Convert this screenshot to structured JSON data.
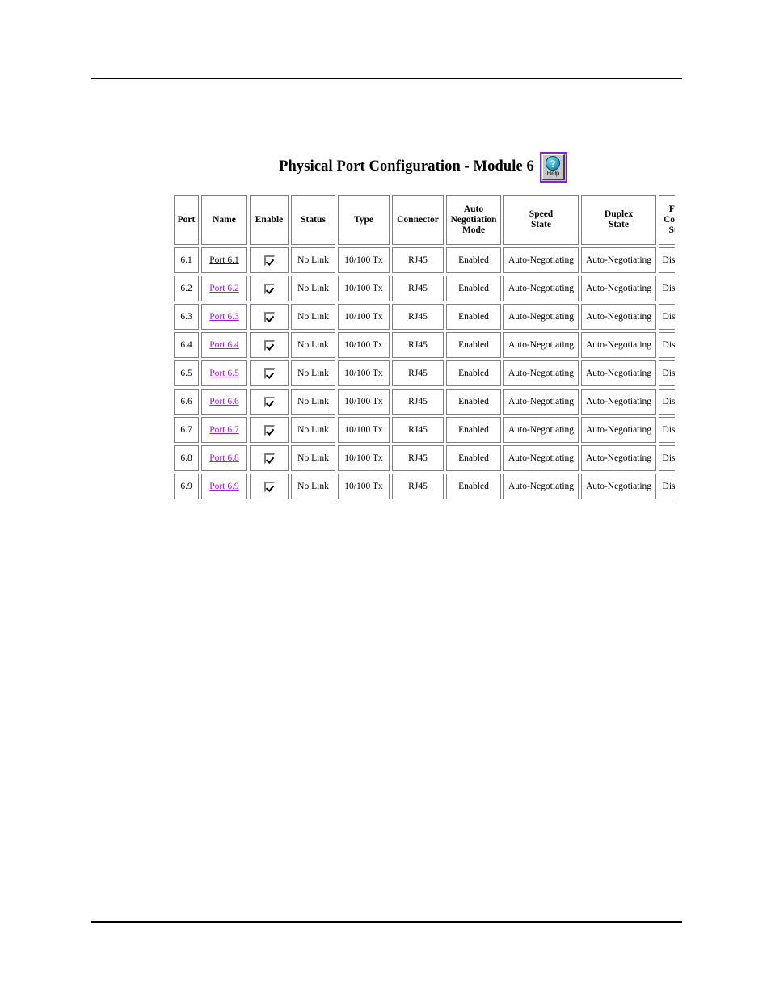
{
  "page": {
    "background": "#ffffff",
    "rules": [
      "top",
      "bottom"
    ]
  },
  "title": {
    "text": "Physical Port Configuration - Module 6"
  },
  "help_button": {
    "label": "Help",
    "glyph": "?",
    "icon": "question-mark-circle-icon",
    "border_color": "#7d26cd",
    "face_color": "#c0c0c0",
    "circle_color": "#2f9fc4"
  },
  "table": {
    "headers": [
      "Port",
      "Name",
      "Enable",
      "Status",
      "Type",
      "Connector",
      "Auto Negotiation Mode",
      "Speed State",
      "Duplex State",
      "Flow Control State"
    ],
    "header_lines": [
      [
        "Port"
      ],
      [
        "Name"
      ],
      [
        "Enable"
      ],
      [
        "Status"
      ],
      [
        "Type"
      ],
      [
        "Connector"
      ],
      [
        "Auto",
        "Negotiation",
        "Mode"
      ],
      [
        "Speed",
        "State"
      ],
      [
        "Duplex",
        "State"
      ],
      [
        "Flow",
        "Control",
        "State"
      ]
    ],
    "link_colors": {
      "visited": "#9a1fd6",
      "active": "#111111"
    },
    "rows": [
      {
        "port": "6.1",
        "name": "Port 6.1",
        "name_state": "active",
        "enable": true,
        "status": "No Link",
        "type": "10/100 Tx",
        "connector": "RJ45",
        "auto_negotiation_mode": "Enabled",
        "speed_state": "Auto-Negotiating",
        "duplex_state": "Auto-Negotiating",
        "flow_control_state": "Disabled"
      },
      {
        "port": "6.2",
        "name": "Port 6.2",
        "name_state": "visited",
        "enable": true,
        "status": "No Link",
        "type": "10/100 Tx",
        "connector": "RJ45",
        "auto_negotiation_mode": "Enabled",
        "speed_state": "Auto-Negotiating",
        "duplex_state": "Auto-Negotiating",
        "flow_control_state": "Disabled"
      },
      {
        "port": "6.3",
        "name": "Port 6.3",
        "name_state": "visited",
        "enable": true,
        "status": "No Link",
        "type": "10/100 Tx",
        "connector": "RJ45",
        "auto_negotiation_mode": "Enabled",
        "speed_state": "Auto-Negotiating",
        "duplex_state": "Auto-Negotiating",
        "flow_control_state": "Disabled"
      },
      {
        "port": "6.4",
        "name": "Port 6.4",
        "name_state": "visited",
        "enable": true,
        "status": "No Link",
        "type": "10/100 Tx",
        "connector": "RJ45",
        "auto_negotiation_mode": "Enabled",
        "speed_state": "Auto-Negotiating",
        "duplex_state": "Auto-Negotiating",
        "flow_control_state": "Disabled"
      },
      {
        "port": "6.5",
        "name": "Port 6.5",
        "name_state": "visited",
        "enable": true,
        "status": "No Link",
        "type": "10/100 Tx",
        "connector": "RJ45",
        "auto_negotiation_mode": "Enabled",
        "speed_state": "Auto-Negotiating",
        "duplex_state": "Auto-Negotiating",
        "flow_control_state": "Disabled"
      },
      {
        "port": "6.6",
        "name": "Port 6.6",
        "name_state": "visited",
        "enable": true,
        "status": "No Link",
        "type": "10/100 Tx",
        "connector": "RJ45",
        "auto_negotiation_mode": "Enabled",
        "speed_state": "Auto-Negotiating",
        "duplex_state": "Auto-Negotiating",
        "flow_control_state": "Disabled"
      },
      {
        "port": "6.7",
        "name": "Port 6.7",
        "name_state": "visited",
        "enable": true,
        "status": "No Link",
        "type": "10/100 Tx",
        "connector": "RJ45",
        "auto_negotiation_mode": "Enabled",
        "speed_state": "Auto-Negotiating",
        "duplex_state": "Auto-Negotiating",
        "flow_control_state": "Disabled"
      },
      {
        "port": "6.8",
        "name": "Port 6.8",
        "name_state": "visited",
        "enable": true,
        "status": "No Link",
        "type": "10/100 Tx",
        "connector": "RJ45",
        "auto_negotiation_mode": "Enabled",
        "speed_state": "Auto-Negotiating",
        "duplex_state": "Auto-Negotiating",
        "flow_control_state": "Disabled"
      },
      {
        "port": "6.9",
        "name": "Port 6.9",
        "name_state": "visited",
        "enable": true,
        "status": "No Link",
        "type": "10/100 Tx",
        "connector": "RJ45",
        "auto_negotiation_mode": "Enabled",
        "speed_state": "Auto-Negotiating",
        "duplex_state": "Auto-Negotiating",
        "flow_control_state": "Disabled"
      }
    ]
  }
}
